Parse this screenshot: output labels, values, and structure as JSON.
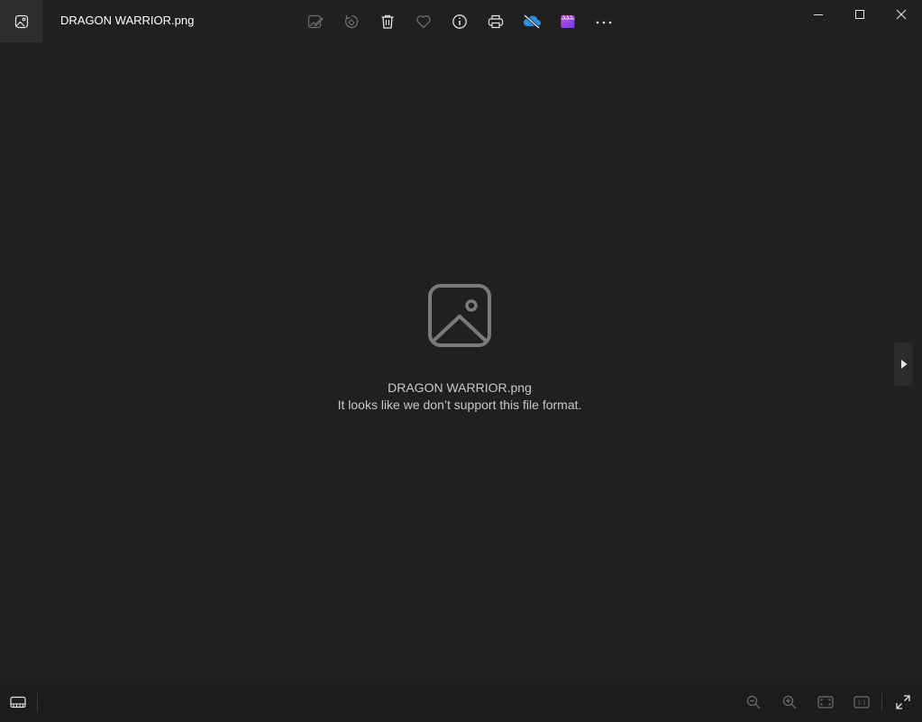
{
  "window": {
    "title": "DRAGON WARRIOR.png"
  },
  "toolbar": {
    "items": [
      {
        "name": "edit-image",
        "icon": "edit-image-icon",
        "enabled": false
      },
      {
        "name": "rotate",
        "icon": "rotate-icon",
        "enabled": false
      },
      {
        "name": "delete",
        "icon": "trash-icon",
        "enabled": true
      },
      {
        "name": "favorite",
        "icon": "heart-icon",
        "enabled": false
      },
      {
        "name": "file-info",
        "icon": "info-icon",
        "enabled": true
      },
      {
        "name": "print",
        "icon": "printer-icon",
        "enabled": true
      },
      {
        "name": "onedrive",
        "icon": "onedrive-cloud-icon",
        "enabled": true
      },
      {
        "name": "clipchamp",
        "icon": "clipchamp-icon",
        "enabled": true
      },
      {
        "name": "more",
        "icon": "more-icon",
        "enabled": true
      }
    ]
  },
  "viewer": {
    "placeholder_icon": "image-placeholder-icon",
    "file_name": "DRAGON WARRIOR.png",
    "message": "It looks like we don’t support this file format."
  },
  "bottom_bar": {
    "actual_size_label": "1:1"
  },
  "colors": {
    "background": "#202020",
    "bottom_bar": "#1c1c1c",
    "onedrive_blue": "#2b8fe6",
    "clipchamp_purple": "#8b5cf6",
    "disabled_icon": "#6e6e6e",
    "enabled_icon": "#e6e6e6"
  }
}
